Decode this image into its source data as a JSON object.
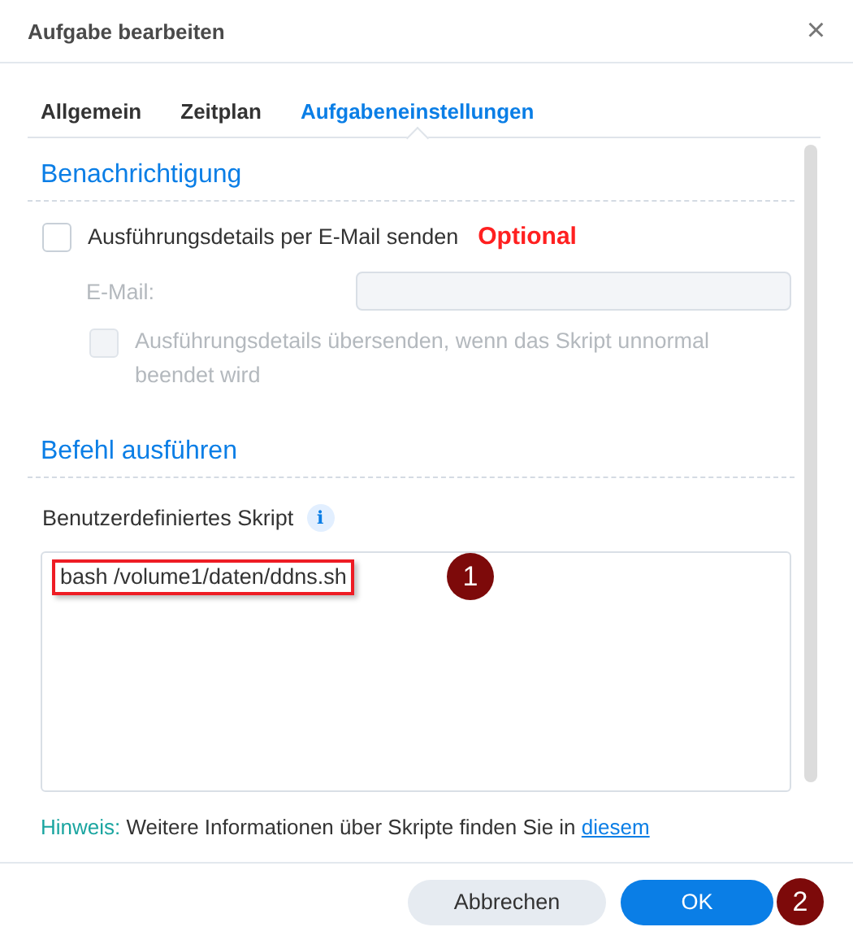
{
  "window": {
    "title": "Aufgabe bearbeiten",
    "close": "×"
  },
  "tabs": [
    {
      "label": "Allgemein",
      "selected": false
    },
    {
      "label": "Zeitplan",
      "selected": false
    },
    {
      "label": "Aufgabeneinstellungen",
      "selected": true
    }
  ],
  "notification": {
    "heading": "Benachrichtigung",
    "send_email": {
      "label": "Ausführungsdetails per E-Mail senden",
      "checked": false,
      "note": "Optional"
    },
    "email": {
      "label": "E-Mail:",
      "disabled": true
    },
    "on_error": {
      "label": "Ausführungsdetails übersenden, wenn das Skript unnormal beendet wird",
      "checked": false,
      "disabled": true
    }
  },
  "command": {
    "heading": "Befehl ausführen",
    "script_label": "Benutzerdefiniertes Skript",
    "info": "i",
    "script": "bash /volume1/daten/ddns.sh",
    "script_badge": "1"
  },
  "hint": {
    "label": "Hinweis:",
    "text": "Weitere Informationen über Skripte finden Sie in",
    "link": "diesem"
  },
  "buttons": [
    {
      "label": "Abbrechen",
      "kind": "secondary"
    },
    {
      "label": "OK",
      "kind": "primary",
      "badge": "2"
    }
  ]
}
